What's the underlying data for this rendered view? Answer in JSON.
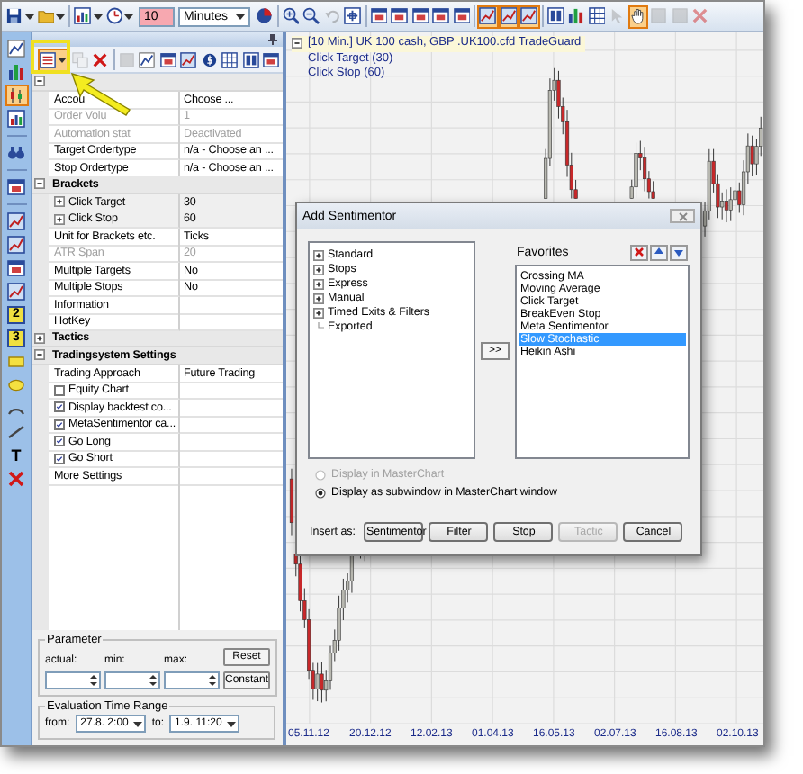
{
  "toolbar": {
    "left_buttons": [
      {
        "kind": "save",
        "on": false,
        "disabled": false
      },
      {
        "kind": "open",
        "on": false,
        "disabled": false
      },
      {
        "kind": "chart",
        "on": false,
        "disabled": false
      },
      {
        "kind": "clock",
        "on": false,
        "disabled": false
      }
    ],
    "interval_value": "10",
    "interval_unit": "Minutes",
    "right_buttons": [
      {
        "kind": "pie",
        "on": false,
        "disabled": false
      },
      {
        "kind": "separator"
      },
      {
        "kind": "zoom-in",
        "on": false,
        "disabled": false
      },
      {
        "kind": "zoom-out",
        "on": false,
        "disabled": false
      },
      {
        "kind": "undo",
        "on": false,
        "disabled": true
      },
      {
        "kind": "fit",
        "on": false,
        "disabled": false
      },
      {
        "kind": "separator"
      },
      {
        "kind": "window",
        "on": false,
        "disabled": false
      },
      {
        "kind": "window",
        "on": false,
        "disabled": false
      },
      {
        "kind": "window",
        "on": false,
        "disabled": false
      },
      {
        "kind": "window",
        "on": false,
        "disabled": false
      },
      {
        "kind": "window",
        "on": false,
        "disabled": false
      },
      {
        "kind": "separator"
      },
      {
        "kind": "trend",
        "on": true,
        "disabled": false
      },
      {
        "kind": "trend",
        "on": true,
        "disabled": false
      },
      {
        "kind": "trend",
        "on": true,
        "disabled": false
      },
      {
        "kind": "separator"
      },
      {
        "kind": "columns",
        "on": false,
        "disabled": false
      },
      {
        "kind": "bars",
        "on": false,
        "disabled": false
      },
      {
        "kind": "grid",
        "on": false,
        "disabled": false
      },
      {
        "kind": "pointer",
        "on": false,
        "disabled": true
      },
      {
        "kind": "hand",
        "on": true,
        "disabled": false
      },
      {
        "kind": "square",
        "on": false,
        "disabled": true
      },
      {
        "kind": "square",
        "on": false,
        "disabled": true
      },
      {
        "kind": "delete",
        "on": false,
        "disabled": true
      }
    ]
  },
  "side_tools": [
    {
      "kind": "line",
      "on": false
    },
    {
      "kind": "bars",
      "on": false
    },
    {
      "kind": "candle",
      "on": true
    },
    {
      "kind": "chart",
      "on": false
    },
    {
      "kind": "separator"
    },
    {
      "kind": "binoculars",
      "on": false
    },
    {
      "kind": "separator"
    },
    {
      "kind": "window",
      "on": false
    },
    {
      "kind": "separator"
    },
    {
      "kind": "trend",
      "on": false
    },
    {
      "kind": "trend",
      "on": false
    },
    {
      "kind": "window",
      "on": false
    },
    {
      "kind": "trend",
      "on": false
    },
    {
      "kind": "numbered",
      "label": "2",
      "on": false
    },
    {
      "kind": "numbered",
      "label": "3",
      "on": false
    },
    {
      "kind": "rect",
      "on": false
    },
    {
      "kind": "ellipse",
      "on": false
    },
    {
      "kind": "arc",
      "on": false
    },
    {
      "kind": "diag",
      "on": false
    },
    {
      "kind": "text",
      "label": "T",
      "on": false
    },
    {
      "kind": "delete",
      "on": false
    }
  ],
  "panel": {
    "tools": [
      {
        "kind": "list",
        "on": true,
        "disabled": false
      },
      {
        "kind": "copy",
        "on": false,
        "disabled": true
      },
      {
        "kind": "delete",
        "on": false,
        "disabled": false
      },
      {
        "kind": "separator"
      },
      {
        "kind": "square",
        "on": false,
        "disabled": true
      },
      {
        "kind": "line",
        "on": false,
        "disabled": false
      },
      {
        "kind": "window",
        "on": false,
        "disabled": false
      },
      {
        "kind": "trend",
        "on": false,
        "disabled": false
      },
      {
        "kind": "coin",
        "on": false,
        "disabled": false
      },
      {
        "kind": "grid",
        "on": false,
        "disabled": false
      },
      {
        "kind": "columns",
        "on": false,
        "disabled": false
      },
      {
        "kind": "window",
        "on": false,
        "disabled": false
      }
    ],
    "properties": [
      {
        "kind": "header",
        "expanded": true
      },
      {
        "kind": "property",
        "label": "Accou",
        "value": "Choose ...",
        "disabled": false
      },
      {
        "kind": "property",
        "label": "Order Volu",
        "value": "1",
        "disabled": true
      },
      {
        "kind": "property",
        "label": "Automation stat",
        "value": "Deactivated",
        "disabled": true
      },
      {
        "kind": "property",
        "label": "Target Ordertype",
        "value": "n/a - Choose an ...",
        "disabled": false
      },
      {
        "kind": "property",
        "label": "Stop Ordertype",
        "value": "n/a - Choose an ...",
        "disabled": false
      },
      {
        "kind": "header",
        "label": "Brackets",
        "expanded": true
      },
      {
        "kind": "expandable",
        "label": "Click Target",
        "value": "30",
        "expanded": false
      },
      {
        "kind": "expandable",
        "label": "Click Stop",
        "value": "60",
        "expanded": false
      },
      {
        "kind": "property",
        "label": "Unit for Brackets etc.",
        "value": "Ticks",
        "disabled": false
      },
      {
        "kind": "property",
        "label": "ATR Span",
        "value": "20",
        "disabled": true
      },
      {
        "kind": "property",
        "label": "Multiple Targets",
        "value": "No",
        "disabled": false
      },
      {
        "kind": "property",
        "label": "Multiple Stops",
        "value": "No",
        "disabled": false
      },
      {
        "kind": "property",
        "label": "Information",
        "disabled": false
      },
      {
        "kind": "property",
        "label": "HotKey",
        "disabled": false
      },
      {
        "kind": "header",
        "label": "Tactics",
        "expanded": false
      },
      {
        "kind": "header",
        "label": "Tradingsystem Settings",
        "expanded": true
      },
      {
        "kind": "property",
        "label": "Trading Approach",
        "value": "Future Trading",
        "disabled": false
      },
      {
        "kind": "checkbox",
        "label": "Equity Chart",
        "checked": false
      },
      {
        "kind": "checkbox",
        "label": "Display backtest co...",
        "checked": true
      },
      {
        "kind": "checkbox",
        "label": "MetaSentimentor ca...",
        "checked": true
      },
      {
        "kind": "checkbox",
        "label": "Go Long",
        "checked": true
      },
      {
        "kind": "checkbox",
        "label": "Go Short",
        "checked": true
      },
      {
        "kind": "property",
        "label": "More Settings",
        "disabled": false
      }
    ],
    "parameter": {
      "title": "Parameter",
      "fields": [
        {
          "label": "actual:"
        },
        {
          "label": "min:"
        },
        {
          "label": "max:"
        }
      ],
      "buttons": [
        "Reset",
        "Constant"
      ]
    },
    "time_range": {
      "title": "Evaluation Time Range",
      "from_label": "from:",
      "from": "27.8.  2:00",
      "to_label": "to:",
      "to": "1.9. 11:20"
    }
  },
  "chart": {
    "legend": [
      "[10 Min.] UK 100 cash, GBP  .UK100.cfd TradeGuard",
      "Click Target  (30)",
      "Click Stop  (60)"
    ],
    "x_labels": [
      "05.11.12",
      "20.12.12",
      "12.02.13",
      "01.04.13",
      "16.05.13",
      "02.07.13",
      "16.08.13",
      "02.10.13"
    ]
  },
  "dialog": {
    "title": "Add Sentimentor",
    "tree": [
      {
        "kind": "folder",
        "label": "Standard",
        "expanded": false
      },
      {
        "kind": "folder",
        "label": "Stops",
        "expanded": false
      },
      {
        "kind": "folder",
        "label": "Express",
        "expanded": false
      },
      {
        "kind": "folder",
        "label": "Manual",
        "expanded": false
      },
      {
        "kind": "folder",
        "label": "Timed Exits & Filters",
        "expanded": false
      },
      {
        "kind": "leaf",
        "label": "Exported"
      }
    ],
    "add_button": ">>",
    "favorites_label": "Favorites",
    "favorites": [
      {
        "label": "Crossing MA",
        "selected": false
      },
      {
        "label": "Moving Average",
        "selected": false
      },
      {
        "label": "Click Target",
        "selected": false
      },
      {
        "label": "BreakEven Stop",
        "selected": false
      },
      {
        "label": "Meta Sentimentor",
        "selected": false
      },
      {
        "label": "Slow Stochastic",
        "selected": true
      },
      {
        "label": "Heikin Ashi",
        "selected": false
      }
    ],
    "options": [
      {
        "label": "Display in MasterChart",
        "selected": false,
        "disabled": true
      },
      {
        "label": "Display as subwindow in MasterChart window",
        "selected": true,
        "disabled": false
      }
    ],
    "insert_label": "Insert as:",
    "buttons": [
      {
        "label": "Sentimentor",
        "disabled": false
      },
      {
        "label": "Filter",
        "disabled": false
      },
      {
        "label": "Stop",
        "disabled": false
      },
      {
        "label": "Tactic",
        "disabled": true
      },
      {
        "label": "Cancel",
        "disabled": false
      }
    ]
  }
}
